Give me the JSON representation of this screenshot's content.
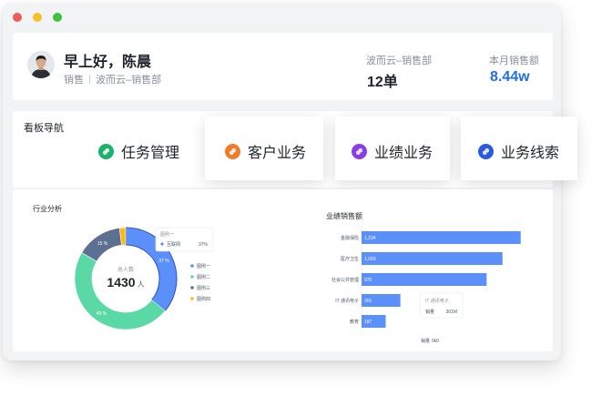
{
  "header": {
    "greeting": "早上好，陈晨",
    "role": "销售",
    "department": "波而云–销售部",
    "stats": [
      {
        "label": "波而云–销售部",
        "value": "12单",
        "color": "#1f2329"
      },
      {
        "label": "本月销售额",
        "value": "8.44w",
        "color": "#1e6fe8"
      }
    ]
  },
  "nav": {
    "title": "看板导航",
    "items": [
      {
        "label": "任务管理",
        "color": "#19b36b"
      },
      {
        "label": "客户业务",
        "color": "#f07b2c"
      },
      {
        "label": "业绩业务",
        "color": "#8a3ee6"
      },
      {
        "label": "业务线索",
        "color": "#2a5ae0"
      }
    ]
  },
  "industry": {
    "title": "行业分析",
    "center_label": "总人数",
    "center_value": "1430",
    "center_unit": "人",
    "tooltip_title": "图例一",
    "tooltip_item": "互联网",
    "tooltip_value": "37%",
    "chart_data": {
      "type": "pie",
      "categories": [
        "图例一",
        "图例二",
        "图例三",
        "图例四"
      ],
      "values": [
        37,
        49,
        15,
        2
      ],
      "slice_labels": [
        "37 %",
        "49 %",
        "15 %",
        ""
      ],
      "colors": [
        "#5b8ff9",
        "#5ad8a6",
        "#5d7092",
        "#f6bd16"
      ]
    }
  },
  "sales": {
    "title": "业绩销售额",
    "tooltip_title": "IT 通讯电子",
    "tooltip_item": "销量",
    "tooltip_value": "301M",
    "axis_label": "销量",
    "axis_value": "0k0",
    "chart_data": {
      "type": "bar",
      "orientation": "horizontal",
      "categories": [
        "金融保险",
        "医疗卫生",
        "社会公共管理",
        "IT 通讯电子",
        "教育"
      ],
      "values": [
        1234,
        1093,
        970,
        301,
        187
      ],
      "value_labels": [
        "1,234",
        "1,093",
        "970",
        "301",
        "187"
      ],
      "color": "#5b8ff9"
    }
  }
}
